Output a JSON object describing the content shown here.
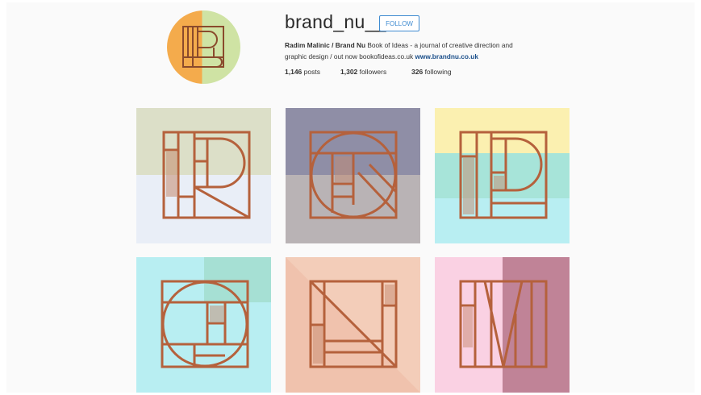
{
  "profile": {
    "username": "brand_nu__",
    "follow_label": "FOLLOW",
    "bio_name": "Radim Malinic / Brand Nu",
    "bio_line1_rest": " Book of Ideas - a journal of creative direction and",
    "bio_line2": "graphic design / out now bookofideas.co.uk ",
    "bio_link": "www.brandnu.co.uk",
    "posts_count": "1,146",
    "posts_label": "posts",
    "followers_count": "1,302",
    "followers_label": "followers",
    "following_count": "326",
    "following_label": "following"
  },
  "colors": {
    "accent": "#3f8bd1",
    "copper": "#b5613c"
  },
  "posts": [
    {
      "letter": "R",
      "bg": "dual-horizontal-sage-lavender"
    },
    {
      "letter": "Q",
      "bg": "dual-horizontal-slate-grey"
    },
    {
      "letter": "P",
      "bg": "yellow-teal-cyan-bands"
    },
    {
      "letter": "O",
      "bg": "aqua-with-mint-corner"
    },
    {
      "letter": "N",
      "bg": "peach-diagonal"
    },
    {
      "letter": "M",
      "bg": "pink-mauve-split"
    }
  ]
}
